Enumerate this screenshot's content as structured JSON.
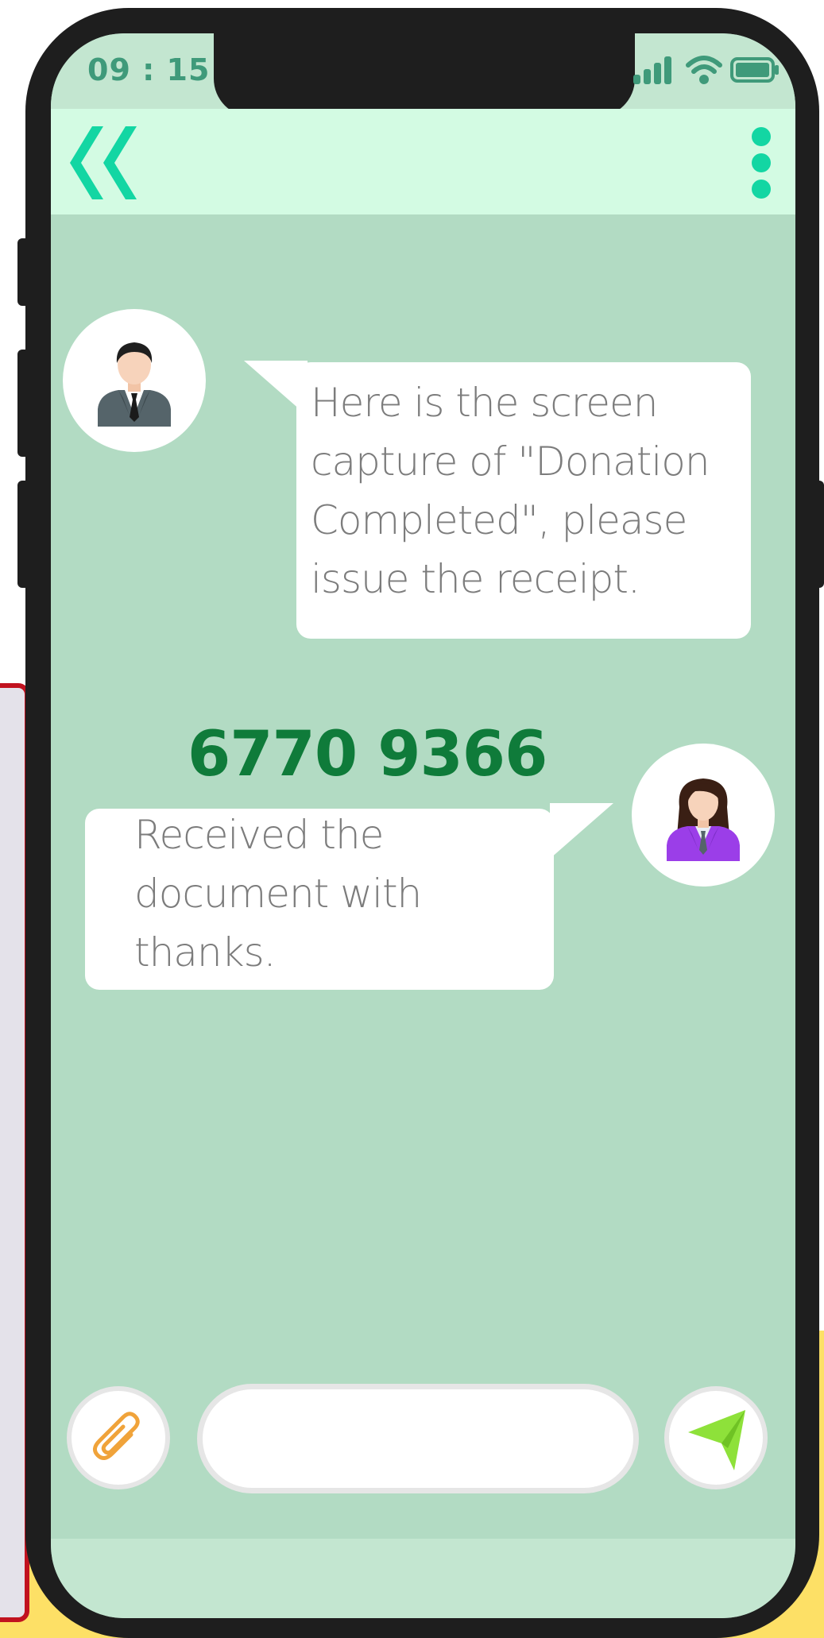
{
  "status_bar": {
    "time": "09 : 15",
    "signal_icon": "signal-bars-icon",
    "wifi_icon": "wifi-icon",
    "battery_icon": "battery-icon"
  },
  "nav": {
    "back_icon": "double-chevron-left-icon",
    "more_icon": "vertical-dots-icon"
  },
  "messages": [
    {
      "sender": "male-user",
      "avatar_icon": "businessman-avatar-icon",
      "lines": [
        "Here is the screen",
        "capture of \"Donation",
        "Completed\", please",
        "issue the receipt."
      ]
    },
    {
      "sender": "female-user",
      "avatar_icon": "businesswoman-avatar-icon",
      "lines": [
        "Received the",
        "document with",
        "thanks."
      ]
    }
  ],
  "phone_number": "6770 9366",
  "composer": {
    "attach_icon": "paperclip-icon",
    "input_value": "",
    "send_icon": "send-arrow-icon"
  },
  "colors": {
    "screen_bg": "#b2dbc3",
    "nav_bg": "#d3fbe3",
    "accent": "#13d6a3",
    "phone_number": "#0f7b3a",
    "send_arrow": "#8ee13a",
    "attach": "#f0a33a",
    "background_yellow": "#fde066"
  }
}
